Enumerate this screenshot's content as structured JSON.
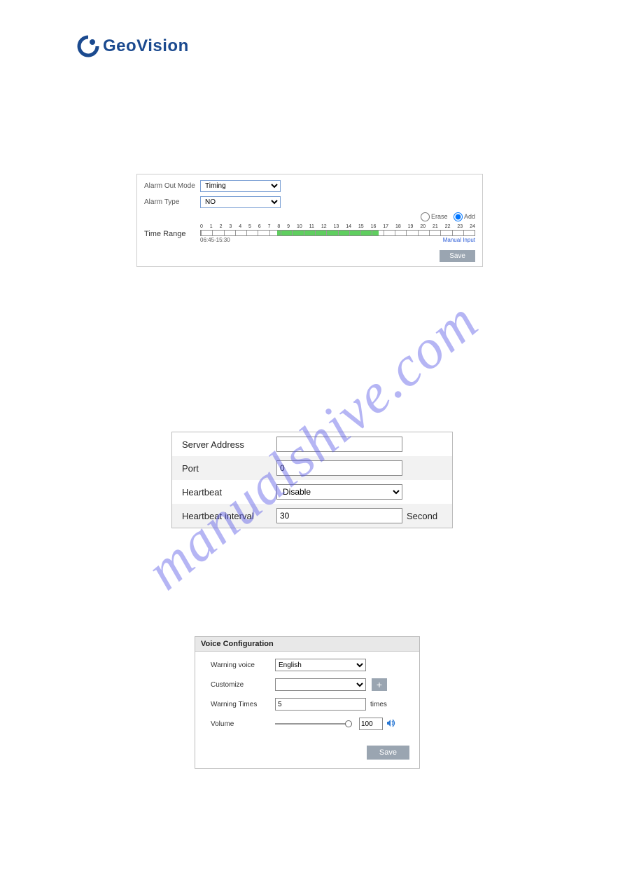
{
  "brand": "GeoVision",
  "panel1": {
    "alarm_out_mode_label": "Alarm Out Mode",
    "alarm_out_mode_value": "Timing",
    "alarm_type_label": "Alarm Type",
    "alarm_type_value": "NO",
    "erase_label": "Erase",
    "add_label": "Add",
    "time_range_label": "Time Range",
    "hours": [
      "0",
      "1",
      "2",
      "3",
      "4",
      "5",
      "6",
      "7",
      "8",
      "9",
      "10",
      "11",
      "12",
      "13",
      "14",
      "15",
      "16",
      "17",
      "18",
      "19",
      "20",
      "21",
      "22",
      "23",
      "24"
    ],
    "range_text": "06:45-15:30",
    "manual_input": "Manual Input",
    "save": "Save"
  },
  "panel2": {
    "server_address_label": "Server Address",
    "server_address_value": "",
    "port_label": "Port",
    "port_value": "0",
    "heartbeat_label": "Heartbeat",
    "heartbeat_value": "Disable",
    "heartbeat_interval_label": "Heartbeat interval",
    "heartbeat_interval_value": "30",
    "heartbeat_interval_unit": "Second"
  },
  "panel3": {
    "header": "Voice Configuration",
    "warning_voice_label": "Warning voice",
    "warning_voice_value": "English",
    "customize_label": "Customize",
    "customize_value": "",
    "warning_times_label": "Warning Times",
    "warning_times_value": "5",
    "warning_times_unit": "times",
    "volume_label": "Volume",
    "volume_value": "100",
    "save": "Save"
  },
  "watermark": "manualshive.com"
}
